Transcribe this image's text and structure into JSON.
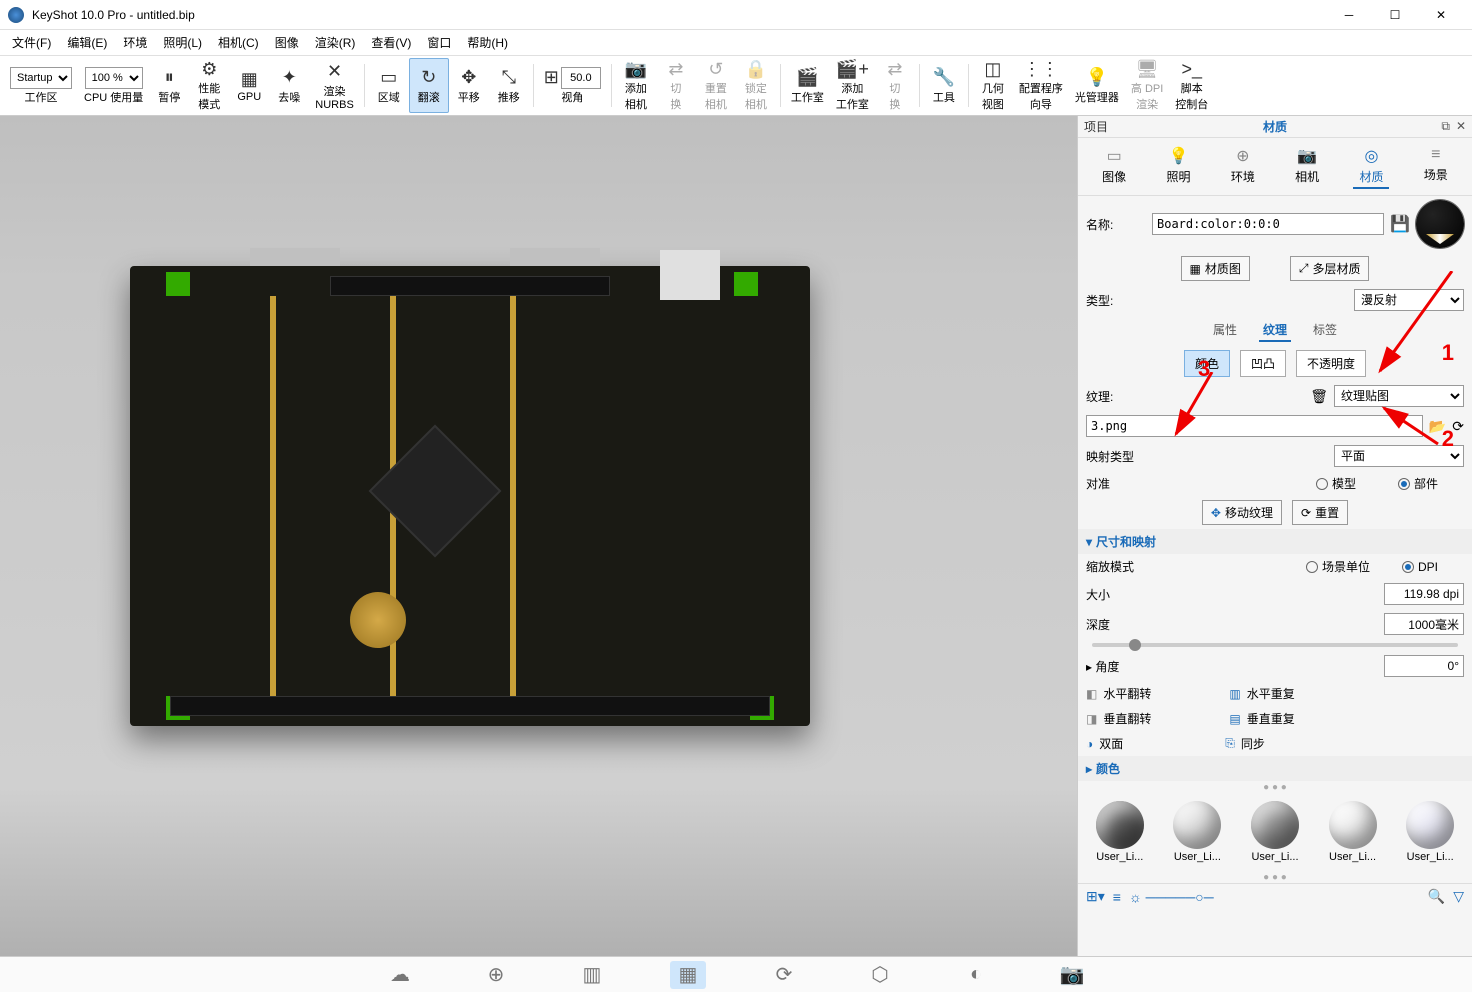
{
  "title": "KeyShot 10.0 Pro  - untitled.bip",
  "menu": [
    "文件(F)",
    "编辑(E)",
    "环境",
    "照明(L)",
    "相机(C)",
    "图像",
    "渲染(R)",
    "查看(V)",
    "窗口",
    "帮助(H)"
  ],
  "toolbar": {
    "startup": "Startup",
    "zoom": "100 %",
    "items": [
      {
        "label": "工作区",
        "sub": ""
      },
      {
        "label": "CPU 使用量",
        "sub": ""
      },
      {
        "label": "暂停",
        "icon": "⏸"
      },
      {
        "label": "性能\n模式",
        "icon": "⚙"
      },
      {
        "label": "GPU",
        "icon": "▦"
      },
      {
        "label": "去噪",
        "icon": "✦"
      },
      {
        "label": "渲染\nNURBS",
        "icon": "✕"
      },
      {
        "label": "区域",
        "icon": "▭"
      },
      {
        "label": "翻滚",
        "icon": "↻",
        "active": true
      },
      {
        "label": "平移",
        "icon": "✥"
      },
      {
        "label": "推移",
        "icon": "⤡"
      },
      {
        "label": "视角",
        "icon": "⊞",
        "val": "50.0"
      },
      {
        "label": "添加\n相机",
        "icon": "📷"
      },
      {
        "label": "切\n换",
        "icon": "⇄",
        "disabled": true
      },
      {
        "label": "重置\n相机",
        "icon": "↺",
        "disabled": true
      },
      {
        "label": "锁定\n相机",
        "icon": "🔒",
        "disabled": true
      },
      {
        "label": "工作室",
        "icon": "🎬"
      },
      {
        "label": "添加\n工作室",
        "icon": "🎬+"
      },
      {
        "label": "切\n换",
        "icon": "⇄",
        "disabled": true
      },
      {
        "label": "工具",
        "icon": "🔧"
      },
      {
        "label": "几何\n视图",
        "icon": "◫"
      },
      {
        "label": "配置程序\n向导",
        "icon": "⋮⋮"
      },
      {
        "label": "光管理器",
        "icon": "💡"
      },
      {
        "label": "高 DPI\n渲染",
        "icon": "🖥",
        "disabled": true
      },
      {
        "label": "脚本\n控制台",
        "icon": ">_"
      }
    ]
  },
  "panel": {
    "project": "项目",
    "header": "材质",
    "tabs": [
      {
        "label": "图像",
        "icon": "▭"
      },
      {
        "label": "照明",
        "icon": "💡"
      },
      {
        "label": "环境",
        "icon": "⊕"
      },
      {
        "label": "相机",
        "icon": "📷"
      },
      {
        "label": "材质",
        "icon": "◎",
        "active": true
      },
      {
        "label": "场景",
        "icon": "≡"
      }
    ],
    "name_label": "名称:",
    "name_value": "Board:color:0:0:0",
    "mat_graph": "材质图",
    "multi_mat": "多层材质",
    "type_label": "类型:",
    "type_value": "漫反射",
    "subtabs": [
      "属性",
      "纹理",
      "标签"
    ],
    "subtab_active": 1,
    "pills": [
      "颜色",
      "凹凸",
      "不透明度"
    ],
    "pill_active": 0,
    "texture_label": "纹理:",
    "texture_dropdown": "纹理贴图",
    "texture_file": "3.png",
    "map_type_label": "映射类型",
    "map_type_value": "平面",
    "align_label": "对准",
    "align_model": "模型",
    "align_part": "部件",
    "move_texture": "移动纹理",
    "reset": "重置",
    "size_section": "尺寸和映射",
    "scale_mode": "缩放模式",
    "scene_units": "场景单位",
    "dpi": "DPI",
    "size_label": "大小",
    "size_value": "119.98 dpi",
    "depth_label": "深度",
    "depth_value": "1000毫米",
    "angle_label": "角度",
    "angle_value": "0°",
    "hflip": "水平翻转",
    "hrepeat": "水平重复",
    "vflip": "垂直翻转",
    "vrepeat": "垂直重复",
    "twosided": "双面",
    "sync": "同步",
    "color_section": "颜色",
    "swatches": [
      {
        "name": "User_Li...",
        "bg": "#555"
      },
      {
        "name": "User_Li...",
        "bg": "#ddd"
      },
      {
        "name": "User_Li...",
        "bg": "#888"
      },
      {
        "name": "User_Li...",
        "bg": "#eee"
      },
      {
        "name": "User_Li...",
        "bg": "#e8e8f4"
      }
    ]
  },
  "annotations": {
    "a1": "1",
    "a2": "2",
    "a3": "3"
  }
}
